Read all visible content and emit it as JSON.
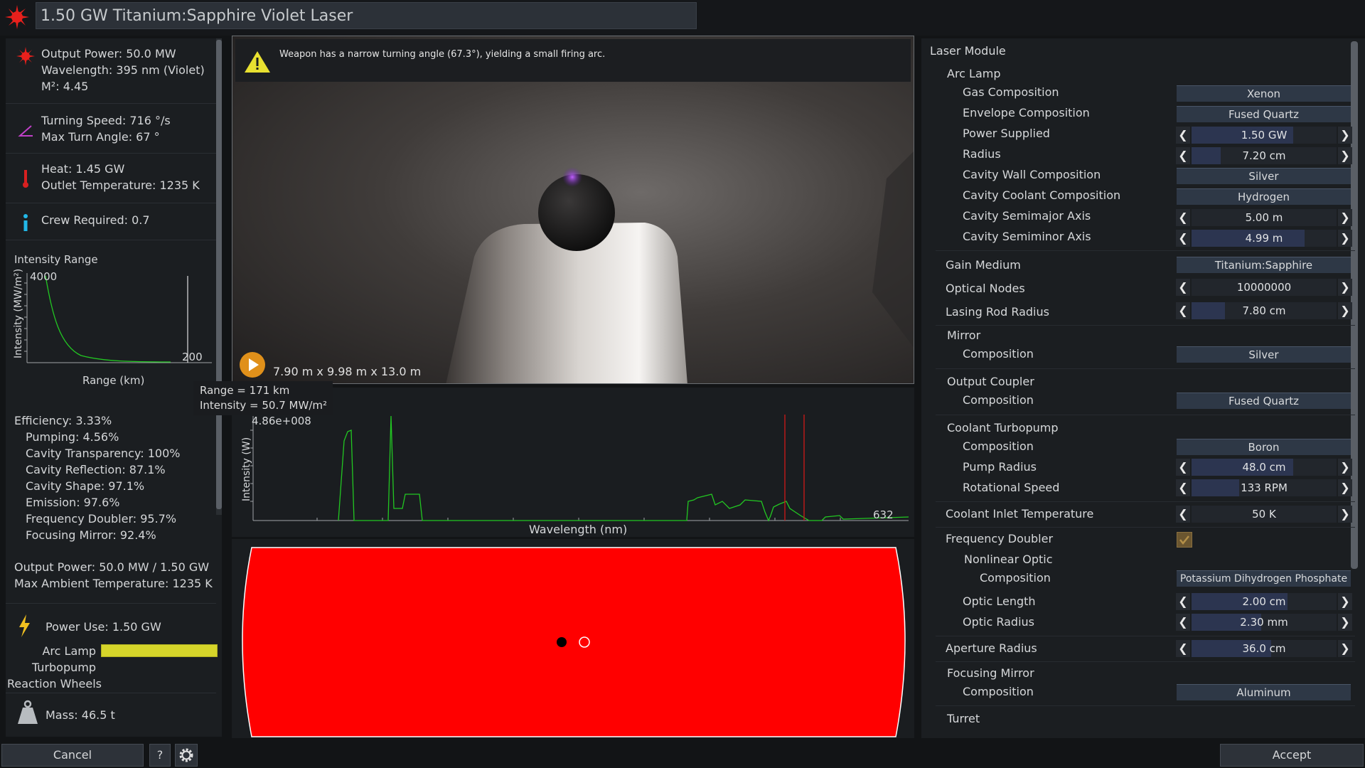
{
  "title": "1.50 GW Titanium:Sapphire Violet Laser",
  "stats": {
    "output_power": "Output Power: 50.0 MW",
    "wavelength": "Wavelength: 395 nm (Violet)",
    "m2": "M²: 4.45",
    "turning_speed": "Turning Speed: 716 °/s",
    "max_turn_angle": "Max Turn Angle: 67 °",
    "heat": "Heat: 1.45 GW",
    "outlet_temp": "Outlet Temperature: 1235 K",
    "crew": "Crew Required: 0.7"
  },
  "intensity_chart": {
    "title": "Intensity Range",
    "y_label": "Intensity (MW/m²)",
    "x_label": "Range (km)",
    "y_tick": "4000",
    "x_tick": "200"
  },
  "tooltip": {
    "range": "Range = 171 km",
    "intensity": "Intensity = 50.7 MW/m²"
  },
  "efficiency": {
    "total": "Efficiency: 3.33%",
    "items": [
      "Pumping: 4.56%",
      "Cavity Transparency: 100%",
      "Cavity Reflection: 87.1%",
      "Cavity Shape: 97.1%",
      "Emission: 97.6%",
      "Frequency Doubler: 95.7%",
      "Focusing Mirror: 92.4%"
    ]
  },
  "summary": {
    "output_power": "Output Power: 50.0 MW / 1.50 GW",
    "max_ambient": "Max Ambient Temperature: 1235 K"
  },
  "power": {
    "power_use": "Power Use: 1.50 GW",
    "arc_lamp": "Arc Lamp",
    "turbopump": "Turbopump",
    "reaction_wheels": "Reaction Wheels"
  },
  "mass": "Mass: 46.5 t",
  "buttons": {
    "cancel": "Cancel",
    "help": "?",
    "accept": "Accept"
  },
  "viewport": {
    "warning": "Weapon has a narrow turning angle (67.3°), yielding a small firing arc.",
    "dimensions": "7.90 m x 9.98 m x 13.0 m"
  },
  "spectrum": {
    "y_label": "Intensity (W)",
    "x_label": "Wavelength (nm)",
    "y_tick": "4.86e+008",
    "x_tick": "632"
  },
  "colors": {
    "accent": "#2c3550",
    "laser": "#ff0000",
    "spectrum": "#1fc41f",
    "marker": "#d01818"
  },
  "right": {
    "laser_module": "Laser Module",
    "arc_lamp": "Arc Lamp",
    "gas_composition": {
      "label": "Gas Composition",
      "value": "Xenon"
    },
    "envelope_composition": {
      "label": "Envelope Composition",
      "value": "Fused Quartz"
    },
    "power_supplied": {
      "label": "Power Supplied",
      "value": "1.50 GW",
      "fill": 0.7
    },
    "radius": {
      "label": "Radius",
      "value": "7.20 cm",
      "fill": 0.2
    },
    "cavity_wall": {
      "label": "Cavity Wall Composition",
      "value": "Silver"
    },
    "cavity_coolant": {
      "label": "Cavity Coolant Composition",
      "value": "Hydrogen"
    },
    "semimajor": {
      "label": "Cavity Semimajor Axis",
      "value": "5.00 m",
      "fill": 0.0
    },
    "semiminor": {
      "label": "Cavity Semiminor Axis",
      "value": "4.99 m",
      "fill": 0.78
    },
    "gain_medium": {
      "label": "Gain Medium",
      "value": "Titanium:Sapphire"
    },
    "optical_nodes": {
      "label": "Optical Nodes",
      "value": "10000000",
      "fill": 0.0
    },
    "lasing_rod_radius": {
      "label": "Lasing Rod Radius",
      "value": "7.80 cm",
      "fill": 0.23
    },
    "mirror": "Mirror",
    "mirror_composition": {
      "label": "Composition",
      "value": "Silver"
    },
    "output_coupler": "Output Coupler",
    "coupler_composition": {
      "label": "Composition",
      "value": "Fused Quartz"
    },
    "coolant_turbopump": "Coolant Turbopump",
    "pump_composition": {
      "label": "Composition",
      "value": "Boron"
    },
    "pump_radius": {
      "label": "Pump Radius",
      "value": "48.0 cm",
      "fill": 0.7
    },
    "rotational_speed": {
      "label": "Rotational Speed",
      "value": "133 RPM",
      "fill": 0.33
    },
    "coolant_inlet": {
      "label": "Coolant Inlet Temperature",
      "value": "50 K",
      "fill": 0.0
    },
    "frequency_doubler": "Frequency Doubler",
    "nonlinear_optic": "Nonlinear Optic",
    "nonlinear_composition": {
      "label": "Composition",
      "value": "Potassium Dihydrogen Phosphate"
    },
    "optic_length": {
      "label": "Optic Length",
      "value": "2.00 cm",
      "fill": 0.66
    },
    "optic_radius": {
      "label": "Optic Radius",
      "value": "2.30 mm",
      "fill": 0.48
    },
    "aperture_radius": {
      "label": "Aperture Radius",
      "value": "36.0 cm",
      "fill": 0.55
    },
    "focusing_mirror": "Focusing Mirror",
    "focusing_composition": {
      "label": "Composition",
      "value": "Aluminum"
    },
    "turret": "Turret"
  }
}
